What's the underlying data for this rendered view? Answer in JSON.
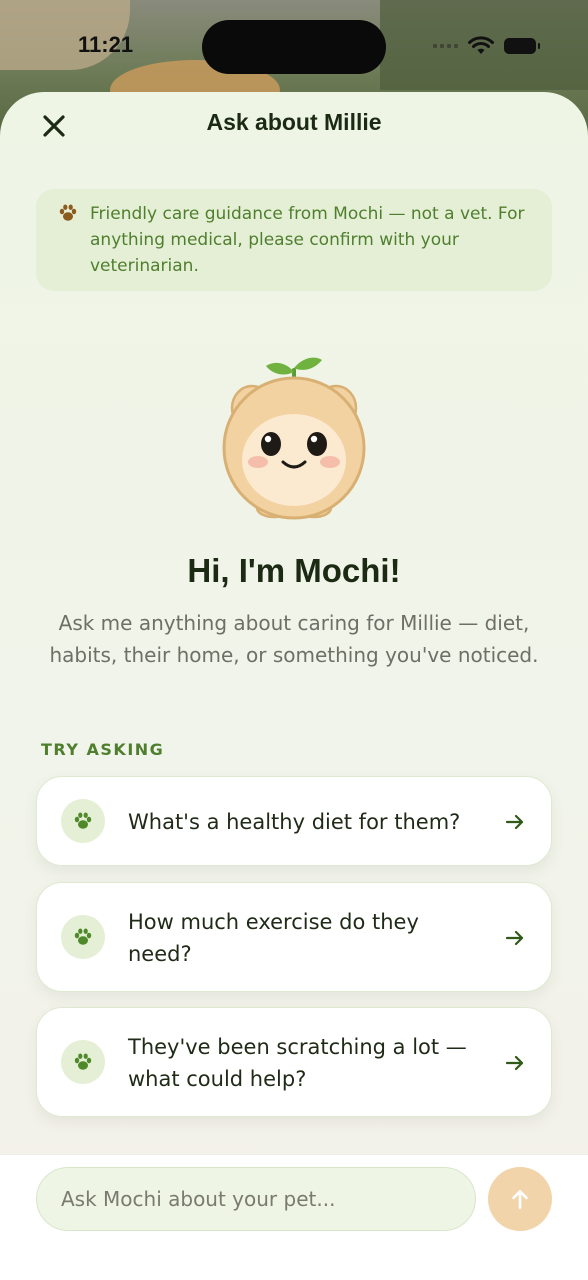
{
  "status_bar": {
    "time": "11:21"
  },
  "sheet": {
    "title": "Ask about Millie",
    "close_icon": "close-icon"
  },
  "disclaimer": {
    "icon": "paw-icon",
    "text": "Friendly care guidance from Mochi — not a vet. For anything medical, please confirm with your veterinarian."
  },
  "mascot": {
    "name": "mochi-mascot"
  },
  "greeting": {
    "title": "Hi, I'm Mochi!",
    "subtitle": "Ask me anything about caring for Millie — diet, habits, their home, or something you've noticed."
  },
  "suggestions": {
    "label": "TRY ASKING",
    "items": [
      {
        "text": "What's a healthy diet for them?",
        "icon": "paw-icon"
      },
      {
        "text": "How much exercise do they need?",
        "icon": "paw-icon"
      },
      {
        "text": "They've been scratching a lot — what could help?",
        "icon": "paw-icon"
      }
    ]
  },
  "composer": {
    "placeholder": "Ask Mochi about your pet...",
    "send_icon": "arrow-up-icon"
  },
  "colors": {
    "accent_green": "#4f7f2e",
    "sheet_bg": "#eef5e5",
    "send_button": "#f2d4aa",
    "title_text": "#1c2a14"
  }
}
